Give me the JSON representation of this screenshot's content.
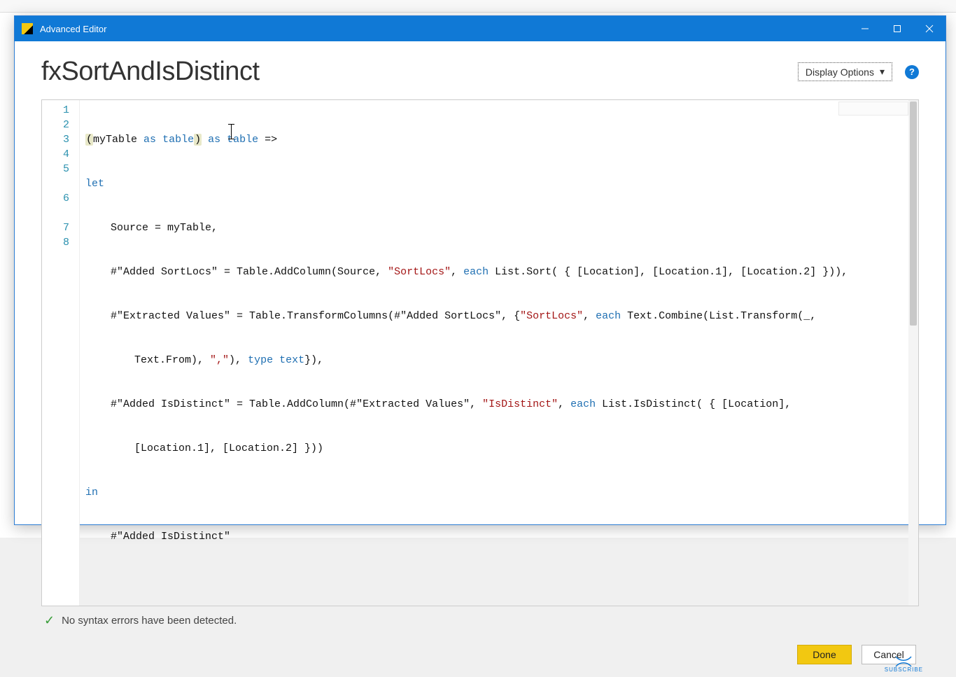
{
  "window": {
    "title": "Advanced Editor"
  },
  "header": {
    "query_name": "fxSortAndIsDistinct",
    "display_options_label": "Display Options"
  },
  "code": {
    "line_numbers": [
      "1",
      "2",
      "3",
      "4",
      "5",
      "5",
      "6",
      "6",
      "7",
      "8"
    ],
    "l1": {
      "a": "(myTable ",
      "kw1": "as",
      "b": " ",
      "kw2": "table",
      "c": ") ",
      "kw3": "as",
      "d": " ",
      "kw4": "table",
      "e": " =>"
    },
    "l2": {
      "kw": "let"
    },
    "l3": {
      "a": "    Source = myTable,"
    },
    "l4": {
      "a": "    #\"Added SortLocs\" = Table.AddColumn(Source, ",
      "s1": "\"SortLocs\"",
      "b": ", ",
      "kw": "each",
      "c": " List.Sort( { [Location], [Location.1], [Location.2] })),"
    },
    "l5": {
      "a": "    #\"Extracted Values\" = Table.TransformColumns(#\"Added SortLocs\", {",
      "s1": "\"SortLocs\"",
      "b": ", ",
      "kw": "each",
      "c": " Text.Combine(List.Transform(_,"
    },
    "l5b": {
      "a": "Text.From), ",
      "s1": "\",\"",
      "b": "), ",
      "kw": "type",
      "c": " ",
      "typ": "text",
      "d": "}),"
    },
    "l6": {
      "a": "    #\"Added IsDistinct\" = Table.AddColumn(#\"Extracted Values\", ",
      "s1": "\"IsDistinct\"",
      "b": ", ",
      "kw": "each",
      "c": " List.IsDistinct( { [Location],"
    },
    "l6b": {
      "a": "[Location.1], [Location.2] }))"
    },
    "l7": {
      "kw": "in"
    },
    "l8": {
      "a": "    #\"Added IsDistinct\""
    }
  },
  "status": {
    "message": "No syntax errors have been detected."
  },
  "footer": {
    "done_label": "Done",
    "cancel_label": "Cancel",
    "subscribe_label": "SUBSCRIBE"
  }
}
